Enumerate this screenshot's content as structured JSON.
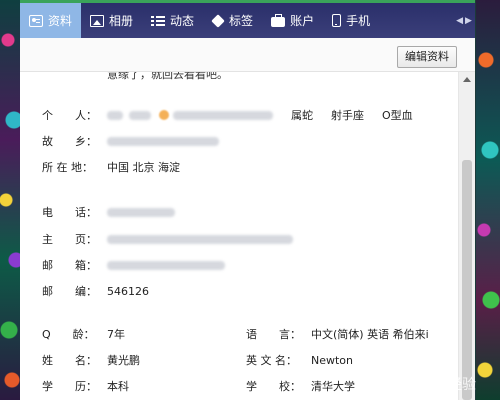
{
  "nav": {
    "tabs": [
      {
        "label": "资料",
        "icon": "profile-card-icon",
        "active": true
      },
      {
        "label": "相册",
        "icon": "photo-icon",
        "active": false
      },
      {
        "label": "动态",
        "icon": "list-icon",
        "active": false
      },
      {
        "label": "标签",
        "icon": "tag-icon",
        "active": false
      },
      {
        "label": "账户",
        "icon": "briefcase-icon",
        "active": false
      },
      {
        "label": "手机",
        "icon": "phone-icon",
        "active": false
      }
    ],
    "prev_glyph": "◀",
    "next_glyph": "▶"
  },
  "toolbar": {
    "edit_label": "编辑资料"
  },
  "clipped_text": "意缘了，就回去看看吧。",
  "profile": {
    "personal": {
      "label": "个　　人：",
      "zodiac": "属蛇",
      "sign": "射手座",
      "blood": "O型血"
    },
    "hometown": {
      "label": "故　　乡："
    },
    "location": {
      "label": "所 在 地：",
      "value": "中国 北京 海淀"
    },
    "phone": {
      "label": "电　　话："
    },
    "homepage": {
      "label": "主　　页："
    },
    "email": {
      "label": "邮　　箱："
    },
    "postcode": {
      "label": "邮　　编：",
      "value": "546126"
    },
    "q_age": {
      "label": "Q　　龄：",
      "value": "7年"
    },
    "language": {
      "label": "语　　言：",
      "value": "中文(简体) 英语 希伯来i"
    },
    "name": {
      "label": "姓　　名：",
      "value": "黄光鹏"
    },
    "english_name": {
      "label": "英 文 名：",
      "value": "Newton"
    },
    "education": {
      "label": "学　　历：",
      "value": "本科"
    },
    "school": {
      "label": "学　　校：",
      "value": "清华大学"
    }
  },
  "watermark": "经验"
}
